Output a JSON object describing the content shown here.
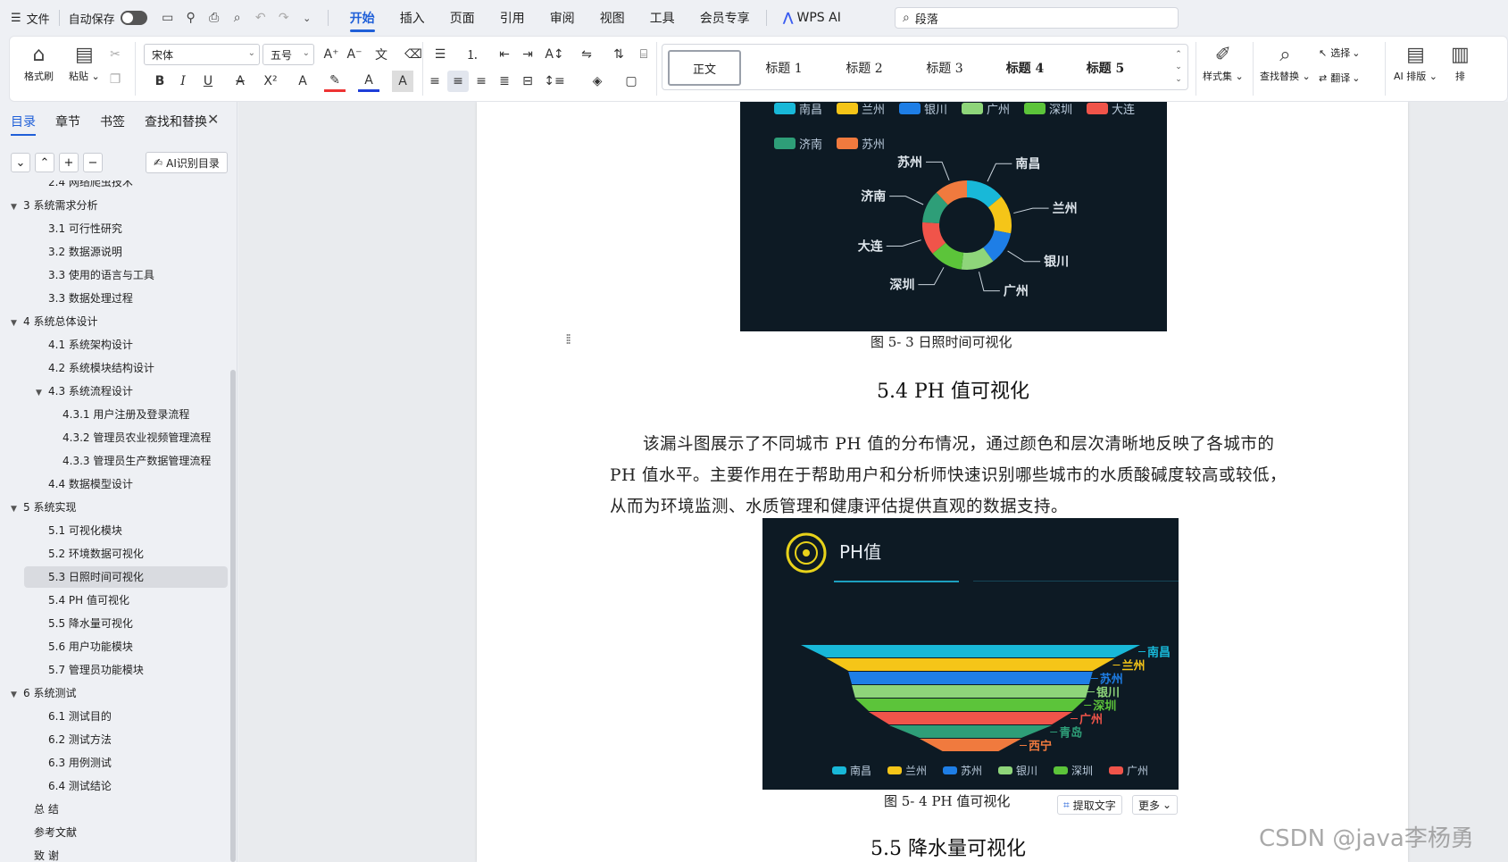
{
  "menubar": {
    "file": "文件",
    "autosave": "自动保存",
    "tabs": [
      "开始",
      "插入",
      "页面",
      "引用",
      "审阅",
      "视图",
      "工具",
      "会员专享"
    ],
    "wps_ai": "WPS AI",
    "search_value": "段落"
  },
  "ribbon": {
    "format_painter": "格式刷",
    "paste": "粘贴",
    "font_name": "宋体",
    "font_size": "五号",
    "styles": [
      "正文",
      "标题 1",
      "标题 2",
      "标题 3",
      "标题 4",
      "标题 5"
    ],
    "style_set": "样式集",
    "find_replace": "查找替换",
    "select": "选择",
    "translate": "翻译",
    "ai_layout": "AI 排版",
    "sort": "排"
  },
  "sidebar": {
    "tabs": [
      "目录",
      "章节",
      "书签",
      "查找和替换"
    ],
    "ai_toc": "AI识别目录",
    "toc": [
      {
        "text": "2.4 网络爬虫技术",
        "level": 2,
        "caret": false
      },
      {
        "text": "3 系统需求分析",
        "level": 1,
        "caret": true
      },
      {
        "text": "3.1 可行性研究",
        "level": 2,
        "caret": false
      },
      {
        "text": "3.2 数据源说明",
        "level": 2,
        "caret": false
      },
      {
        "text": "3.3 使用的语言与工具",
        "level": 2,
        "caret": false
      },
      {
        "text": "3.3 数据处理过程",
        "level": 2,
        "caret": false
      },
      {
        "text": "4 系统总体设计",
        "level": 1,
        "caret": true
      },
      {
        "text": "4.1 系统架构设计",
        "level": 2,
        "caret": false
      },
      {
        "text": "4.2 系统模块结构设计",
        "level": 2,
        "caret": false
      },
      {
        "text": "4.3 系统流程设计",
        "level": 2,
        "caret": true
      },
      {
        "text": "4.3.1 用户注册及登录流程",
        "level": 3,
        "caret": false
      },
      {
        "text": "4.3.2 管理员农业视频管理流程",
        "level": 3,
        "caret": false
      },
      {
        "text": "4.3.3 管理员生产数据管理流程",
        "level": 3,
        "caret": false
      },
      {
        "text": "4.4 数据模型设计",
        "level": 2,
        "caret": false
      },
      {
        "text": "5 系统实现",
        "level": 1,
        "caret": true
      },
      {
        "text": "5.1 可视化模块",
        "level": 2,
        "caret": false
      },
      {
        "text": "5.2  环境数据可视化",
        "level": 2,
        "caret": false
      },
      {
        "text": "5.3  日照时间可视化",
        "level": 2,
        "caret": false,
        "selected": true
      },
      {
        "text": "5.4 PH 值可视化",
        "level": 2,
        "caret": false
      },
      {
        "text": "5.5  降水量可视化",
        "level": 2,
        "caret": false
      },
      {
        "text": "5.6 用户功能模块",
        "level": 2,
        "caret": false
      },
      {
        "text": "5.7 管理员功能模块",
        "level": 2,
        "caret": false
      },
      {
        "text": "6 系统测试",
        "level": 1,
        "caret": true
      },
      {
        "text": "6.1  测试目的",
        "level": 2,
        "caret": false
      },
      {
        "text": "6.2  测试方法",
        "level": 2,
        "caret": false
      },
      {
        "text": "6.3  用例测试",
        "level": 2,
        "caret": false
      },
      {
        "text": "6.4 测试结论",
        "level": 2,
        "caret": false
      },
      {
        "text": "总    结",
        "level": 0,
        "caret": false
      },
      {
        "text": "参考文献",
        "level": 0,
        "caret": false
      },
      {
        "text": "致    谢",
        "level": 0,
        "caret": false
      }
    ]
  },
  "document": {
    "fig53_caption": "图 5- 3  日照时间可视化",
    "sec54_title": "5.4 PH 值可视化",
    "paragraph": "该漏斗图展示了不同城市 PH 值的分布情况，通过颜色和层次清晰地反映了各城市的 PH 值水平。主要作用在于帮助用户和分析师快速识别哪些城市的水质酸碱度较高或较低，从而为环境监测、水质管理和健康评估提供直观的数据支持。",
    "fig54_caption": "图 5- 4 PH 值可视化",
    "sec55_title": "5.5  降水量可视化",
    "extract_text": "提取文字",
    "more": "更多",
    "watermark": "CSDN @java李杨勇"
  },
  "chart_data": [
    {
      "type": "pie",
      "title": "",
      "categories": [
        "南昌",
        "兰州",
        "银川",
        "广州",
        "深圳",
        "大连",
        "济南",
        "苏州"
      ],
      "values": [
        14,
        14,
        12,
        12,
        12,
        12,
        12,
        12
      ],
      "colors": [
        "#18b8d8",
        "#f5c518",
        "#1e7ee6",
        "#8ed57a",
        "#5cc43a",
        "#f0544a",
        "#2e9e78",
        "#f07a3e"
      ],
      "legend": "top-left"
    },
    {
      "type": "funnel",
      "title": "PH值",
      "categories": [
        "南昌",
        "兰州",
        "苏州",
        "银川",
        "深圳",
        "广州",
        "青岛",
        "西宁"
      ],
      "values": [
        100,
        85,
        72,
        70,
        68,
        60,
        48,
        30
      ],
      "colors": [
        "#18b8d8",
        "#f5c518",
        "#1e7ee6",
        "#8ed57a",
        "#5cc43a",
        "#f0544a",
        "#2e9e78",
        "#f07a3e"
      ],
      "legend": [
        "南昌",
        "兰州",
        "苏州",
        "银川",
        "深圳",
        "广州"
      ],
      "legend_position": "bottom"
    }
  ]
}
